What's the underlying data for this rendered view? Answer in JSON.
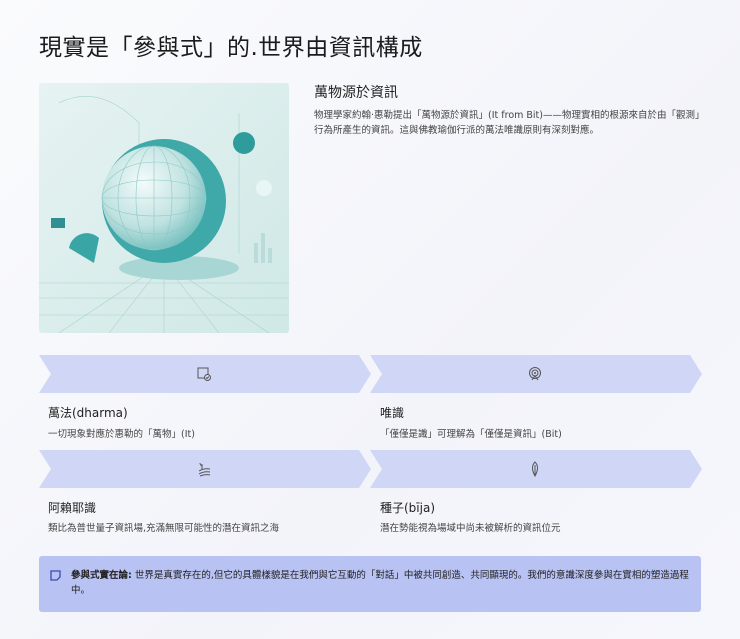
{
  "title": "現實是「參與式」的.世界由資訊構成",
  "intro": {
    "heading": "萬物源於資訊",
    "body": "物理學家約翰·惠勒提出「萬物源於資訊」(It from Bit)——物理實相的根源來自於由「觀測」行為所產生的資訊。這與佛教瑜伽行派的萬法唯識原則有深刻對應。"
  },
  "cards": [
    {
      "label": "萬法(dharma)",
      "desc": "一切現象對應於惠勒的「萬物」(It)",
      "icon": "image-check-icon"
    },
    {
      "label": "唯識",
      "desc": "「僅僅是識」可理解為「僅僅是資訊」(Bit)",
      "icon": "broadcast-icon"
    },
    {
      "label": "阿賴耶識",
      "desc": "類比為普世量子資訊場,充滿無限可能性的潛在資訊之海",
      "icon": "field-sprout-icon"
    },
    {
      "label": "種子(bīja)",
      "desc": "潛在勢能視為場域中尚未被解析的資訊位元",
      "icon": "seed-icon"
    }
  ],
  "callout": {
    "label": "參與式實在論:",
    "text": " 世界是真實存在的,但它的具體樣貌是在我們與它互動的「對話」中被共同創造、共同顯現的。我們的意識深度參與在實相的塑造過程中。"
  },
  "colors": {
    "chevron": "#d0d6f6",
    "callout": "#b8c2f3",
    "accent": "#3b4bb5"
  }
}
